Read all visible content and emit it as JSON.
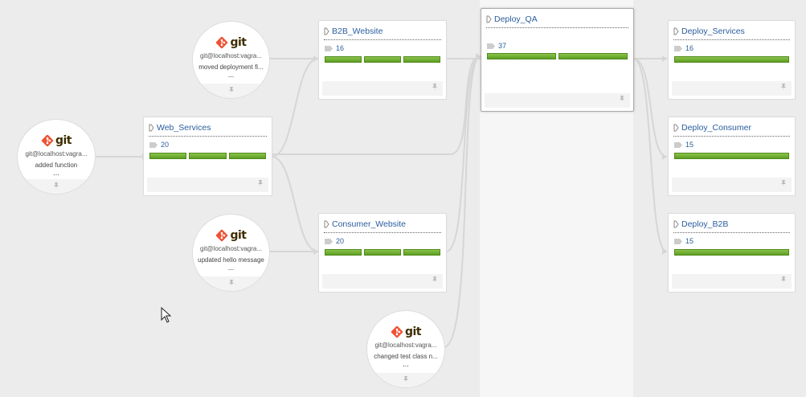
{
  "colors": {
    "link": "#2a5d9e",
    "success_bar": "#6aab2b",
    "git_logo": "#f05033",
    "git_text": "#3e2c00"
  },
  "icons": {
    "pipeline": "pipeline-icon",
    "run_label": "tag-icon",
    "pin": "pin-icon",
    "git": "git-logo-icon"
  },
  "materials": [
    {
      "logo": "git",
      "repo": "git@localhost:vagra...",
      "message": "added function",
      "more": "..."
    },
    {
      "logo": "git",
      "repo": "git@localhost:vagra...",
      "message": "moved deployment fi...",
      "more": "..."
    },
    {
      "logo": "git",
      "repo": "git@localhost:vagra...",
      "message": "updated hello message",
      "more": "..."
    },
    {
      "logo": "git",
      "repo": "git@localhost:vagra...",
      "message": "changed test class n...",
      "more": "..."
    }
  ],
  "pipelines": {
    "web_services": {
      "name": "Web_Services",
      "run": "20",
      "stages": 3
    },
    "b2b_website": {
      "name": "B2B_Website",
      "run": "16",
      "stages": 3
    },
    "consumer_website": {
      "name": "Consumer_Website",
      "run": "20",
      "stages": 3
    },
    "deploy_qa": {
      "name": "Deploy_QA",
      "run": "37",
      "stages": 2
    },
    "deploy_services": {
      "name": "Deploy_Services",
      "run": "16",
      "stages": 1
    },
    "deploy_consumer": {
      "name": "Deploy_Consumer",
      "run": "15",
      "stages": 1
    },
    "deploy_b2b": {
      "name": "Deploy_B2B",
      "run": "15",
      "stages": 1
    }
  }
}
